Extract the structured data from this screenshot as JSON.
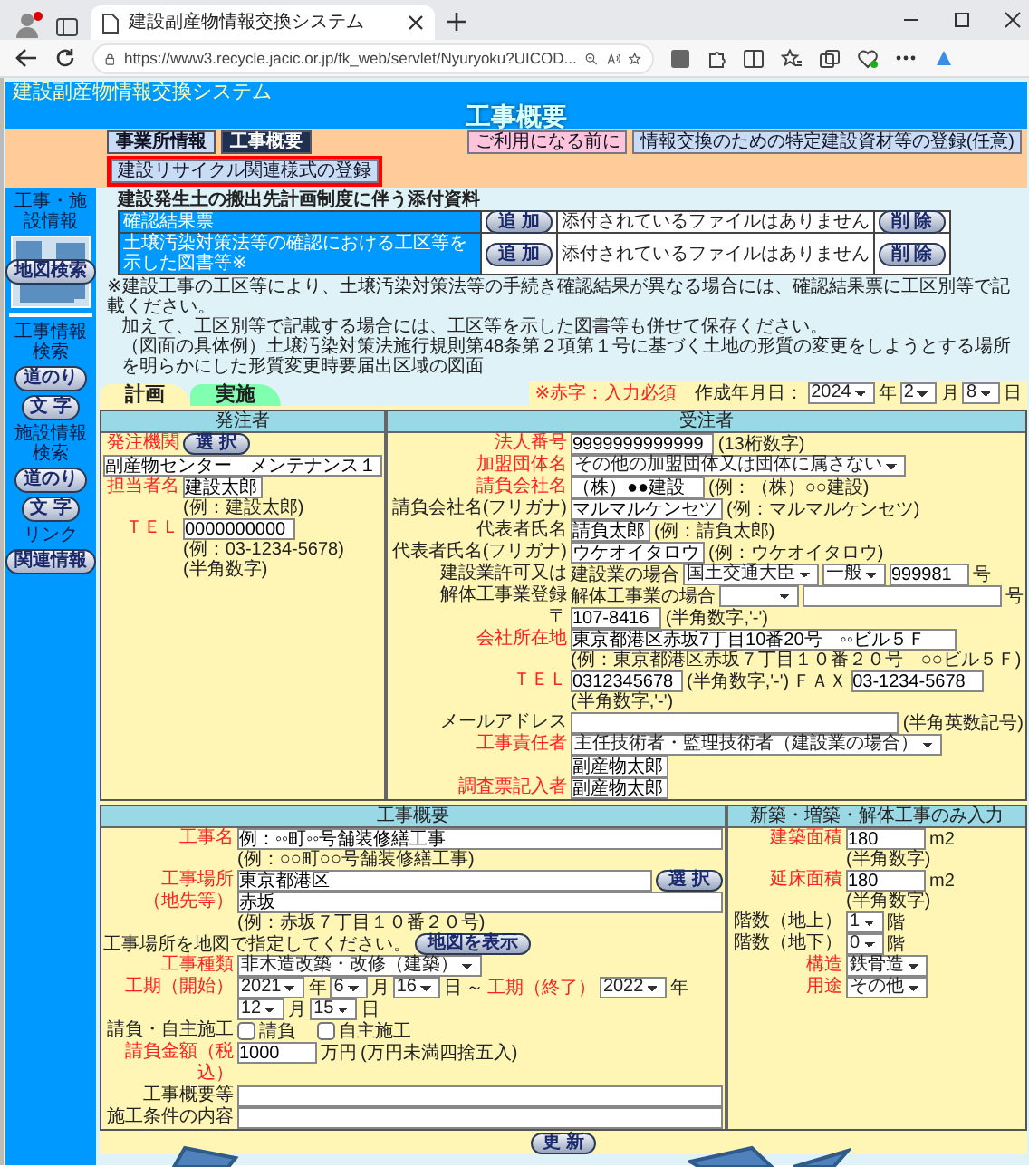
{
  "browser": {
    "tab_title": "建設副産物情報交換システム",
    "url": "https://www3.recycle.jacic.or.jp/fk_web/servlet/Nyuryoku?UICOD..."
  },
  "header": {
    "system_title": "建設副産物情報交換システム",
    "page_title": "工事概要"
  },
  "nav_tabs": [
    {
      "label": "事業所情報",
      "selected": false
    },
    {
      "label": "工事概要",
      "selected": true
    }
  ],
  "links": [
    {
      "label": "ご利用になる前に",
      "kind": "notice",
      "highlighted": false
    },
    {
      "label": "情報交換のための特定建設資材等の登録(任意)",
      "kind": "normal",
      "highlighted": false
    },
    {
      "label": "建設リサイクル関連様式の登録",
      "kind": "normal",
      "highlighted": true
    }
  ],
  "sidebar": {
    "sections": [
      {
        "title": "工事・施設情報",
        "kind": "map",
        "buttons": [
          "地図検索"
        ]
      },
      {
        "title": "工事情報検索",
        "kind": "search",
        "buttons": [
          "道のり",
          "文 字"
        ]
      },
      {
        "title": "施設情報検索",
        "kind": "search",
        "buttons": [
          "道のり",
          "文 字"
        ]
      },
      {
        "title": "リンク",
        "kind": "search",
        "buttons": [
          "関連情報"
        ]
      }
    ]
  },
  "attachments": {
    "title": "建設発生土の搬出先計画制度に伴う添付資料",
    "rows": [
      {
        "label": "確認結果票",
        "add_button": "追 加",
        "status": "添付されているファイルはありません",
        "delete_button": "削 除"
      },
      {
        "label": "土壌汚染対策法等の確認における工区等を示した図書等※",
        "add_button": "追 加",
        "status": "添付されているファイルはありません",
        "delete_button": "削 除"
      }
    ],
    "notes": [
      "※建設工事の工区等により、土壌汚染対策法等の手続き確認結果が異なる場合には、確認結果票に工区別等で記載ください。",
      "加えて、工区別等で記載する場合には、工区等を示した図書等も併せて保存ください。",
      "（図面の具体例）土壌汚染対策法施行規則第48条第２項第１号に基づく土地の形質の変更をしようとする場所を明らかにした形質変更時要届出区域の図面"
    ]
  },
  "plan_tabs": [
    {
      "label": "計画",
      "selected": true
    },
    {
      "label": "実施",
      "selected": false
    }
  ],
  "required_note": "※赤字：入力必須",
  "created_date": {
    "label": "作成年月日：",
    "year": "2024",
    "year_unit": "年",
    "month": "2",
    "month_unit": "月",
    "day": "8",
    "day_unit": "日"
  },
  "orderer": {
    "heading": "発注者",
    "rows": [
      {
        "label": "発注機関",
        "required": true,
        "items": [
          {
            "kind": "button",
            "value": "選 択"
          }
        ]
      },
      {
        "items": [
          {
            "kind": "field",
            "value": "副産物センター　メンテナンス１"
          }
        ]
      },
      {
        "label": "担当者名",
        "required": true,
        "items": [
          {
            "kind": "field",
            "value": "建設太郎"
          },
          {
            "kind": "hint",
            "value": "(例：建設太郎)"
          }
        ]
      },
      {
        "label": "ＴＥＬ",
        "required": true,
        "items": [
          {
            "kind": "field",
            "value": "0000000000"
          },
          {
            "kind": "hint",
            "value": "(例：03-1234-5678)"
          },
          {
            "kind": "hint",
            "value": "(半角数字)"
          }
        ]
      }
    ]
  },
  "contractor": {
    "heading": "受注者",
    "rows": [
      {
        "label": "法人番号",
        "required": true,
        "items": [
          {
            "kind": "field",
            "value": "9999999999999"
          },
          {
            "kind": "text",
            "value": "(13桁数字)"
          }
        ]
      },
      {
        "label": "加盟団体名",
        "required": true,
        "items": [
          {
            "kind": "select",
            "value": "その他の加盟団体又は団体に属さない"
          }
        ]
      },
      {
        "label": "請負会社名",
        "required": true,
        "items": [
          {
            "kind": "field",
            "value": "（株）●●建設"
          },
          {
            "kind": "text",
            "value": "(例：（株）○○建設)"
          }
        ]
      },
      {
        "label": "請負会社名(フリガナ)",
        "required": false,
        "items": [
          {
            "kind": "field",
            "value": "マルマルケンセツ"
          },
          {
            "kind": "text",
            "value": "(例：マルマルケンセツ)"
          }
        ]
      },
      {
        "label": "代表者氏名",
        "required": false,
        "items": [
          {
            "kind": "field",
            "value": "請負太郎"
          },
          {
            "kind": "text",
            "value": "(例：請負太郎)"
          }
        ]
      },
      {
        "label": "代表者氏名(フリガナ)",
        "required": false,
        "items": [
          {
            "kind": "field",
            "value": "ウケオイタロウ"
          },
          {
            "kind": "text",
            "value": "(例：ウケオイタロウ)"
          }
        ]
      },
      {
        "label": "建設業許可又は",
        "required": false,
        "items": [
          {
            "kind": "text",
            "value": "建設業の場合"
          },
          {
            "kind": "select",
            "value": "国土交通大臣"
          },
          {
            "kind": "select",
            "value": "一般"
          },
          {
            "kind": "field",
            "value": "999981"
          },
          {
            "kind": "text",
            "value": "号"
          }
        ]
      },
      {
        "label": "解体工事業登録",
        "required": false,
        "items": [
          {
            "kind": "text",
            "value": "解体工事業の場合"
          },
          {
            "kind": "select"
          },
          {
            "kind": "wide_field"
          },
          {
            "kind": "text",
            "value": "号"
          }
        ]
      },
      {
        "label": "〒",
        "required": false,
        "items": [
          {
            "kind": "field",
            "value": "107-8416"
          },
          {
            "kind": "text",
            "value": "(半角数字,'-')"
          }
        ]
      },
      {
        "label": "会社所在地",
        "required": true,
        "items": [
          {
            "kind": "field",
            "value": "東京都港区赤坂7丁目10番20号　◦◦ビル５Ｆ"
          },
          {
            "kind": "hint",
            "value": "(例：東京都港区赤坂７丁目１０番２０号　○○ビル５Ｆ)"
          }
        ]
      },
      {
        "label": "ＴＥＬ",
        "required": true,
        "items": [
          {
            "kind": "field",
            "value": "0312345678"
          },
          {
            "kind": "text",
            "value": "(半角数字,'-')"
          },
          {
            "kind": "text",
            "value": "ＦＡＸ"
          },
          {
            "kind": "field",
            "value": "03-1234-5678"
          },
          {
            "kind": "text",
            "value": "(半角数字,'-')"
          }
        ]
      },
      {
        "label": "メールアドレス",
        "required": false,
        "items": [
          {
            "kind": "wide_field"
          },
          {
            "kind": "text",
            "value": "(半角英数記号)"
          }
        ]
      },
      {
        "label": "工事責任者",
        "required": true,
        "items": [
          {
            "kind": "select",
            "value": "主任技術者・監理技術者（建設業の場合）"
          },
          {
            "kind": "field",
            "value": "副産物太郎"
          }
        ]
      },
      {
        "label": "調査票記入者",
        "required": true,
        "items": [
          {
            "kind": "field",
            "value": "副産物太郎"
          }
        ]
      }
    ]
  },
  "works": {
    "heading": "工事概要",
    "rows": [
      {
        "label": "工事名",
        "required": true,
        "items": [
          {
            "kind": "wide_field",
            "value": "例：◦◦町◦◦号舗装修繕工事"
          },
          {
            "kind": "hint",
            "value": "(例：○○町○○号舗装修繕工事)"
          }
        ]
      },
      {
        "label": "工事場所",
        "required": true,
        "items": [
          {
            "kind": "wide_field",
            "value": "東京都港区"
          },
          {
            "kind": "button",
            "value": "選 択"
          }
        ]
      },
      {
        "label": "（地先等）",
        "required": true,
        "items": [
          {
            "kind": "wide_field",
            "value": "赤坂"
          },
          {
            "kind": "hint",
            "value": "(例：赤坂７丁目１０番２０号)"
          }
        ]
      },
      {
        "items": [
          {
            "kind": "text",
            "value": "工事場所を地図で指定してください。"
          },
          {
            "kind": "button",
            "value": "地図を表示"
          }
        ]
      },
      {
        "label": "工事種類",
        "required": true,
        "items": [
          {
            "kind": "select",
            "value": "非木造改築・改修（建築）"
          }
        ]
      },
      {
        "label": "工期（開始）",
        "required": true,
        "items": [
          {
            "kind": "select",
            "value": "2021"
          },
          {
            "kind": "text",
            "value": "年"
          },
          {
            "kind": "select",
            "value": "6"
          },
          {
            "kind": "text",
            "value": "月"
          },
          {
            "kind": "select",
            "value": "16"
          },
          {
            "kind": "text",
            "value": "日"
          },
          {
            "kind": "text",
            "value": "～"
          },
          {
            "kind": "req_text",
            "value": "工期（終了）"
          },
          {
            "kind": "select",
            "value": "2022"
          },
          {
            "kind": "text",
            "value": "年"
          },
          {
            "kind": "select",
            "value": "12"
          },
          {
            "kind": "text",
            "value": "月"
          },
          {
            "kind": "select",
            "value": "15"
          },
          {
            "kind": "text",
            "value": "日"
          }
        ]
      },
      {
        "label": "請負・自主施工",
        "required": false,
        "items": [
          {
            "kind": "checkbox",
            "value": "請負",
            "checked": false
          },
          {
            "kind": "checkbox",
            "value": "自主施工",
            "checked": false
          }
        ]
      },
      {
        "label": "請負金額（税込）",
        "required": true,
        "items": [
          {
            "kind": "field",
            "value": "1000"
          },
          {
            "kind": "text",
            "value": "万円"
          },
          {
            "kind": "text",
            "value": "(万円未満四捨五入)"
          }
        ]
      },
      {
        "label": "工事概要等",
        "required": false,
        "items": [
          {
            "kind": "wide_field"
          }
        ]
      },
      {
        "label": "施工条件の内容",
        "required": false,
        "items": [
          {
            "kind": "wide_field"
          }
        ]
      }
    ]
  },
  "building": {
    "heading": "新築・増築・解体工事のみ入力",
    "rows": [
      {
        "label": "建築面積",
        "required": true,
        "items": [
          {
            "kind": "field",
            "value": "180"
          },
          {
            "kind": "text",
            "value": "m2"
          },
          {
            "kind": "hint",
            "value": "(半角数字)"
          }
        ]
      },
      {
        "label": "延床面積",
        "required": true,
        "items": [
          {
            "kind": "field",
            "value": "180"
          },
          {
            "kind": "text",
            "value": "m2"
          },
          {
            "kind": "hint",
            "value": "(半角数字)"
          }
        ]
      },
      {
        "label": "階数（地上）",
        "required": false,
        "items": [
          {
            "kind": "select",
            "value": "1"
          },
          {
            "kind": "text",
            "value": "階"
          }
        ]
      },
      {
        "label": "階数（地下）",
        "required": false,
        "items": [
          {
            "kind": "select",
            "value": "0"
          },
          {
            "kind": "text",
            "value": "階"
          }
        ]
      },
      {
        "label": "構造",
        "required": true,
        "items": [
          {
            "kind": "select",
            "value": "鉄骨造"
          }
        ]
      },
      {
        "label": "用途",
        "required": true,
        "items": [
          {
            "kind": "select",
            "value": "その他"
          }
        ]
      }
    ]
  },
  "update_button": "更 新"
}
